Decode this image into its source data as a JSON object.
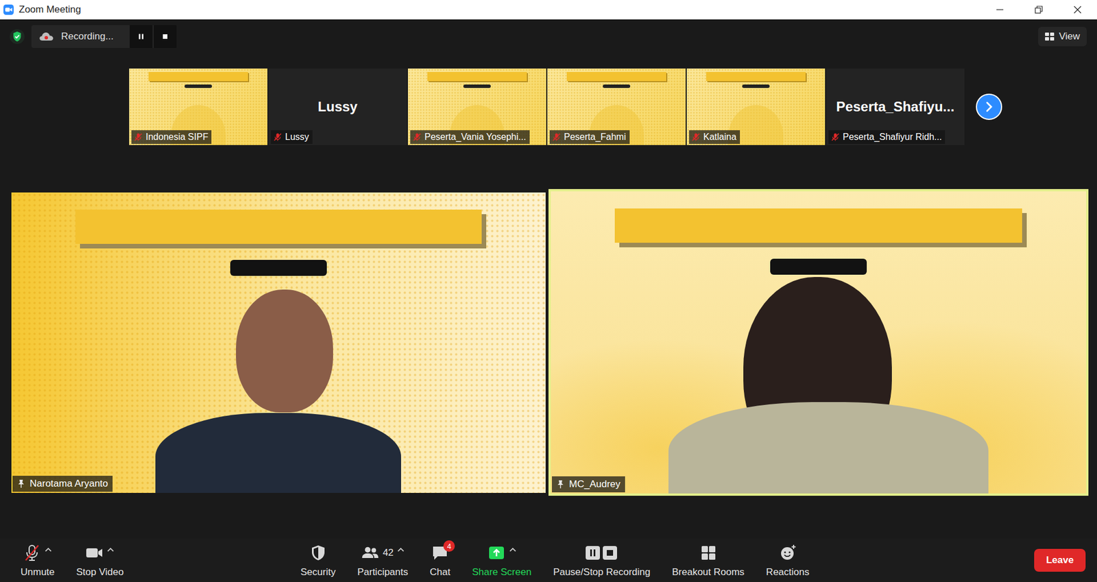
{
  "window": {
    "title": "Zoom Meeting"
  },
  "recording": {
    "label": "Recording...",
    "paused": false
  },
  "view_button": {
    "label": "View"
  },
  "gallery_strip": [
    {
      "name": "Indonesia SIPF",
      "kind": "video",
      "muted": true,
      "display": ""
    },
    {
      "name": "Lussy",
      "kind": "name",
      "muted": true,
      "display": "Lussy"
    },
    {
      "name": "Peserta_Vania Yosephi...",
      "kind": "video",
      "muted": true,
      "display": ""
    },
    {
      "name": "Peserta_Fahmi",
      "kind": "video",
      "muted": true,
      "display": ""
    },
    {
      "name": "Katlaina",
      "kind": "video",
      "muted": true,
      "display": ""
    },
    {
      "name": "Peserta_Shafiyur Ridh...",
      "kind": "name",
      "muted": true,
      "display": "Peserta_Shafiyu..."
    }
  ],
  "speakers": [
    {
      "name": "Narotama Aryanto",
      "pinned": true,
      "active": false
    },
    {
      "name": "MC_Audrey",
      "pinned": true,
      "active": true
    }
  ],
  "toolbar": [
    {
      "label": "Unmute",
      "kind": "mic",
      "muted": true,
      "caret": true,
      "count": "",
      "badge": "",
      "color": "#e6e6e6"
    },
    {
      "label": "Stop Video",
      "kind": "video",
      "muted": false,
      "caret": true,
      "count": "",
      "badge": "",
      "color": "#e6e6e6"
    },
    {
      "label": "Security",
      "kind": "security",
      "muted": false,
      "caret": false,
      "count": "",
      "badge": "",
      "color": "#e6e6e6"
    },
    {
      "label": "Participants",
      "kind": "participants",
      "muted": false,
      "caret": true,
      "count": "42",
      "badge": "",
      "color": "#e6e6e6"
    },
    {
      "label": "Chat",
      "kind": "chat",
      "muted": false,
      "caret": false,
      "count": "",
      "badge": "4",
      "color": "#e6e6e6"
    },
    {
      "label": "Share Screen",
      "kind": "share",
      "muted": false,
      "caret": true,
      "count": "",
      "badge": "",
      "color": "#23d959"
    },
    {
      "label": "Pause/Stop Recording",
      "kind": "record",
      "muted": false,
      "caret": false,
      "count": "",
      "badge": "",
      "color": "#e6e6e6"
    },
    {
      "label": "Breakout Rooms",
      "kind": "rooms",
      "muted": false,
      "caret": false,
      "count": "",
      "badge": "",
      "color": "#e6e6e6"
    },
    {
      "label": "Reactions",
      "kind": "reactions",
      "muted": false,
      "caret": false,
      "count": "",
      "badge": "",
      "color": "#e6e6e6"
    }
  ],
  "leave_button": {
    "label": "Leave"
  }
}
